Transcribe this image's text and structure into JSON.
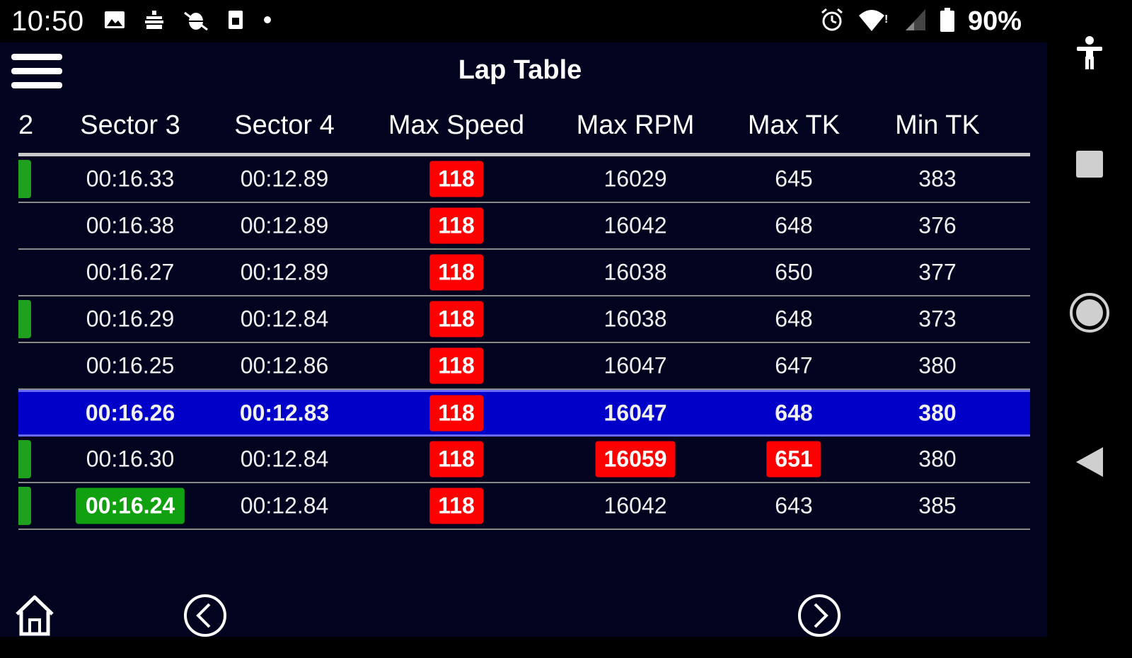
{
  "status_bar": {
    "time": "10:50",
    "icons": [
      "image-icon",
      "usb-icon",
      "debug-icon",
      "sim-icon",
      "dot-icon"
    ],
    "right_icons": [
      "alarm-icon",
      "wifi-icon",
      "signal-icon",
      "battery-icon"
    ],
    "battery": "90%"
  },
  "app": {
    "title": "Lap Table",
    "columns": [
      "2",
      "Sector 3",
      "Sector 4",
      "Max Speed",
      "Max RPM",
      "Max TK",
      "Min TK"
    ],
    "rows": [
      {
        "marker": "green",
        "sector3": "00:16.33",
        "sector4": "00:12.89",
        "max_speed": "118",
        "max_rpm": "16029",
        "max_tk": "645",
        "min_tk": "383"
      },
      {
        "marker": "none",
        "sector3": "00:16.38",
        "sector4": "00:12.89",
        "max_speed": "118",
        "max_rpm": "16042",
        "max_tk": "648",
        "min_tk": "376"
      },
      {
        "marker": "none",
        "sector3": "00:16.27",
        "sector4": "00:12.89",
        "max_speed": "118",
        "max_rpm": "16038",
        "max_tk": "650",
        "min_tk": "377"
      },
      {
        "marker": "green",
        "sector3": "00:16.29",
        "sector4": "00:12.84",
        "max_speed": "118",
        "max_rpm": "16038",
        "max_tk": "648",
        "min_tk": "373"
      },
      {
        "marker": "none",
        "sector3": "00:16.25",
        "sector4": "00:12.86",
        "max_speed": "118",
        "max_rpm": "16047",
        "max_tk": "647",
        "min_tk": "380"
      },
      {
        "marker": "none",
        "selected": true,
        "sector3": "00:16.26",
        "sector4": "00:12.83",
        "max_speed": "118",
        "max_rpm": "16047",
        "max_tk": "648",
        "min_tk": "380"
      },
      {
        "marker": "green",
        "sector3": "00:16.30",
        "sector4": "00:12.84",
        "max_speed": "118",
        "max_rpm": "16059",
        "max_rpm_highlight": true,
        "max_tk": "651",
        "max_tk_highlight": true,
        "min_tk": "380"
      },
      {
        "marker": "green",
        "sector3": "00:16.24",
        "sector3_highlight": true,
        "sector4": "00:12.84",
        "max_speed": "118",
        "max_rpm": "16042",
        "max_tk": "643",
        "min_tk": "385"
      }
    ]
  },
  "colors": {
    "background": "#02031f",
    "selected_row": "#0000c8",
    "alert_red": "#ff0000",
    "best_green": "#10a010"
  },
  "bottom_nav": {
    "icons": [
      "home-icon",
      "prev-icon",
      "next-icon"
    ]
  },
  "system_nav": {
    "icons": [
      "accessibility-icon",
      "recents-icon",
      "home-circle-icon",
      "back-icon"
    ]
  }
}
